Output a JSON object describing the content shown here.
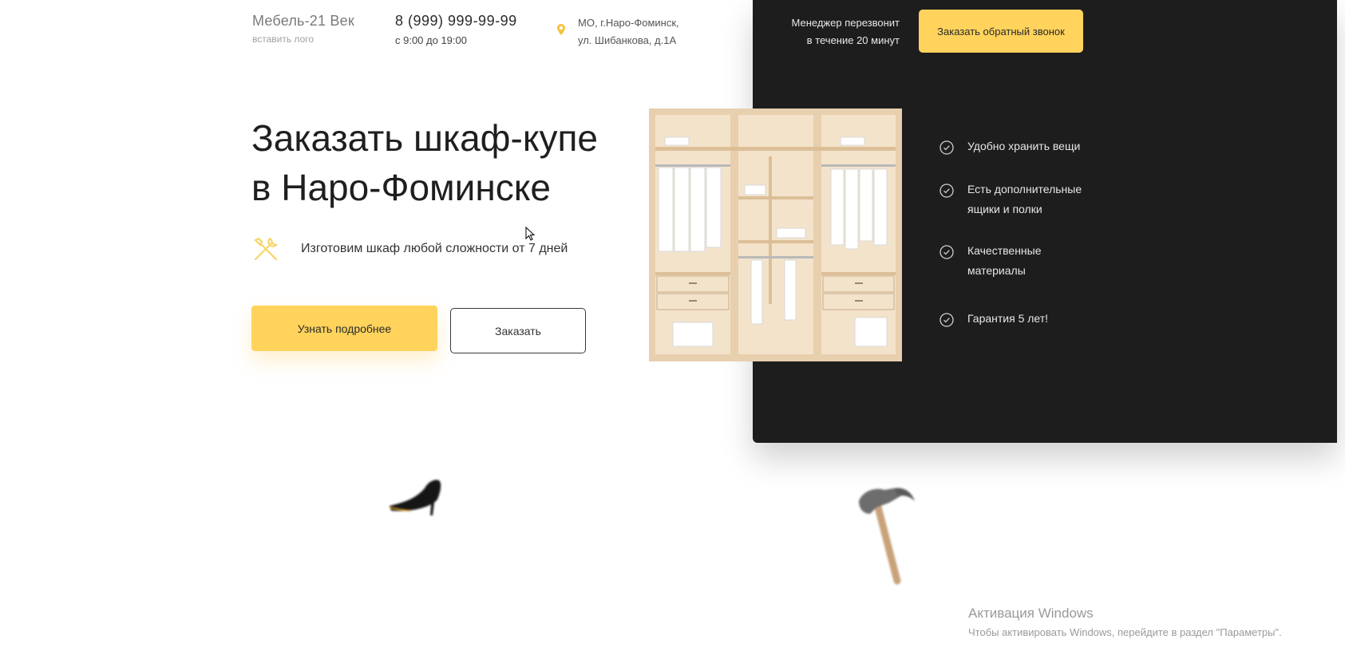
{
  "header": {
    "logo_name": "Мебель-21 Век",
    "logo_sub": "вставить лого",
    "phone": "8 (999) 999-99-99",
    "hours": "с 9:00 до 19:00",
    "address_line1": "МО, г.Наро-Фоминск,",
    "address_line2": "ул. Шибанкова, д.1А",
    "callback_note_line1": "Менеджер перезвонит",
    "callback_note_line2": "в течение 20 минут",
    "callback_button": "Заказать обратный звонок"
  },
  "hero": {
    "title_line1": "Заказать шкаф-купе",
    "title_line2": "в Наро-Фоминске",
    "feature_text": "Изготовим шкаф любой сложности от 7 дней",
    "primary_button": "Узнать подробнее",
    "secondary_button": "Заказать"
  },
  "benefits": [
    {
      "line1": "Удобно хранить вещи",
      "line2": ""
    },
    {
      "line1": "Есть дополнительные",
      "line2": "ящики и полки"
    },
    {
      "line1": "Качественные",
      "line2": "материалы"
    },
    {
      "line1": "Гарантия 5 лет!",
      "line2": ""
    }
  ],
  "watermark": {
    "title": "Активация Windows",
    "subtitle": "Чтобы активировать Windows, перейдите в раздел \"Параметры\"."
  },
  "colors": {
    "accent": "#ffd35c",
    "dark_panel": "#1e1d1d",
    "text": "#222222"
  },
  "icons": [
    "location-pin-icon",
    "tools-icon",
    "check-circle-icon",
    "cursor-icon"
  ]
}
